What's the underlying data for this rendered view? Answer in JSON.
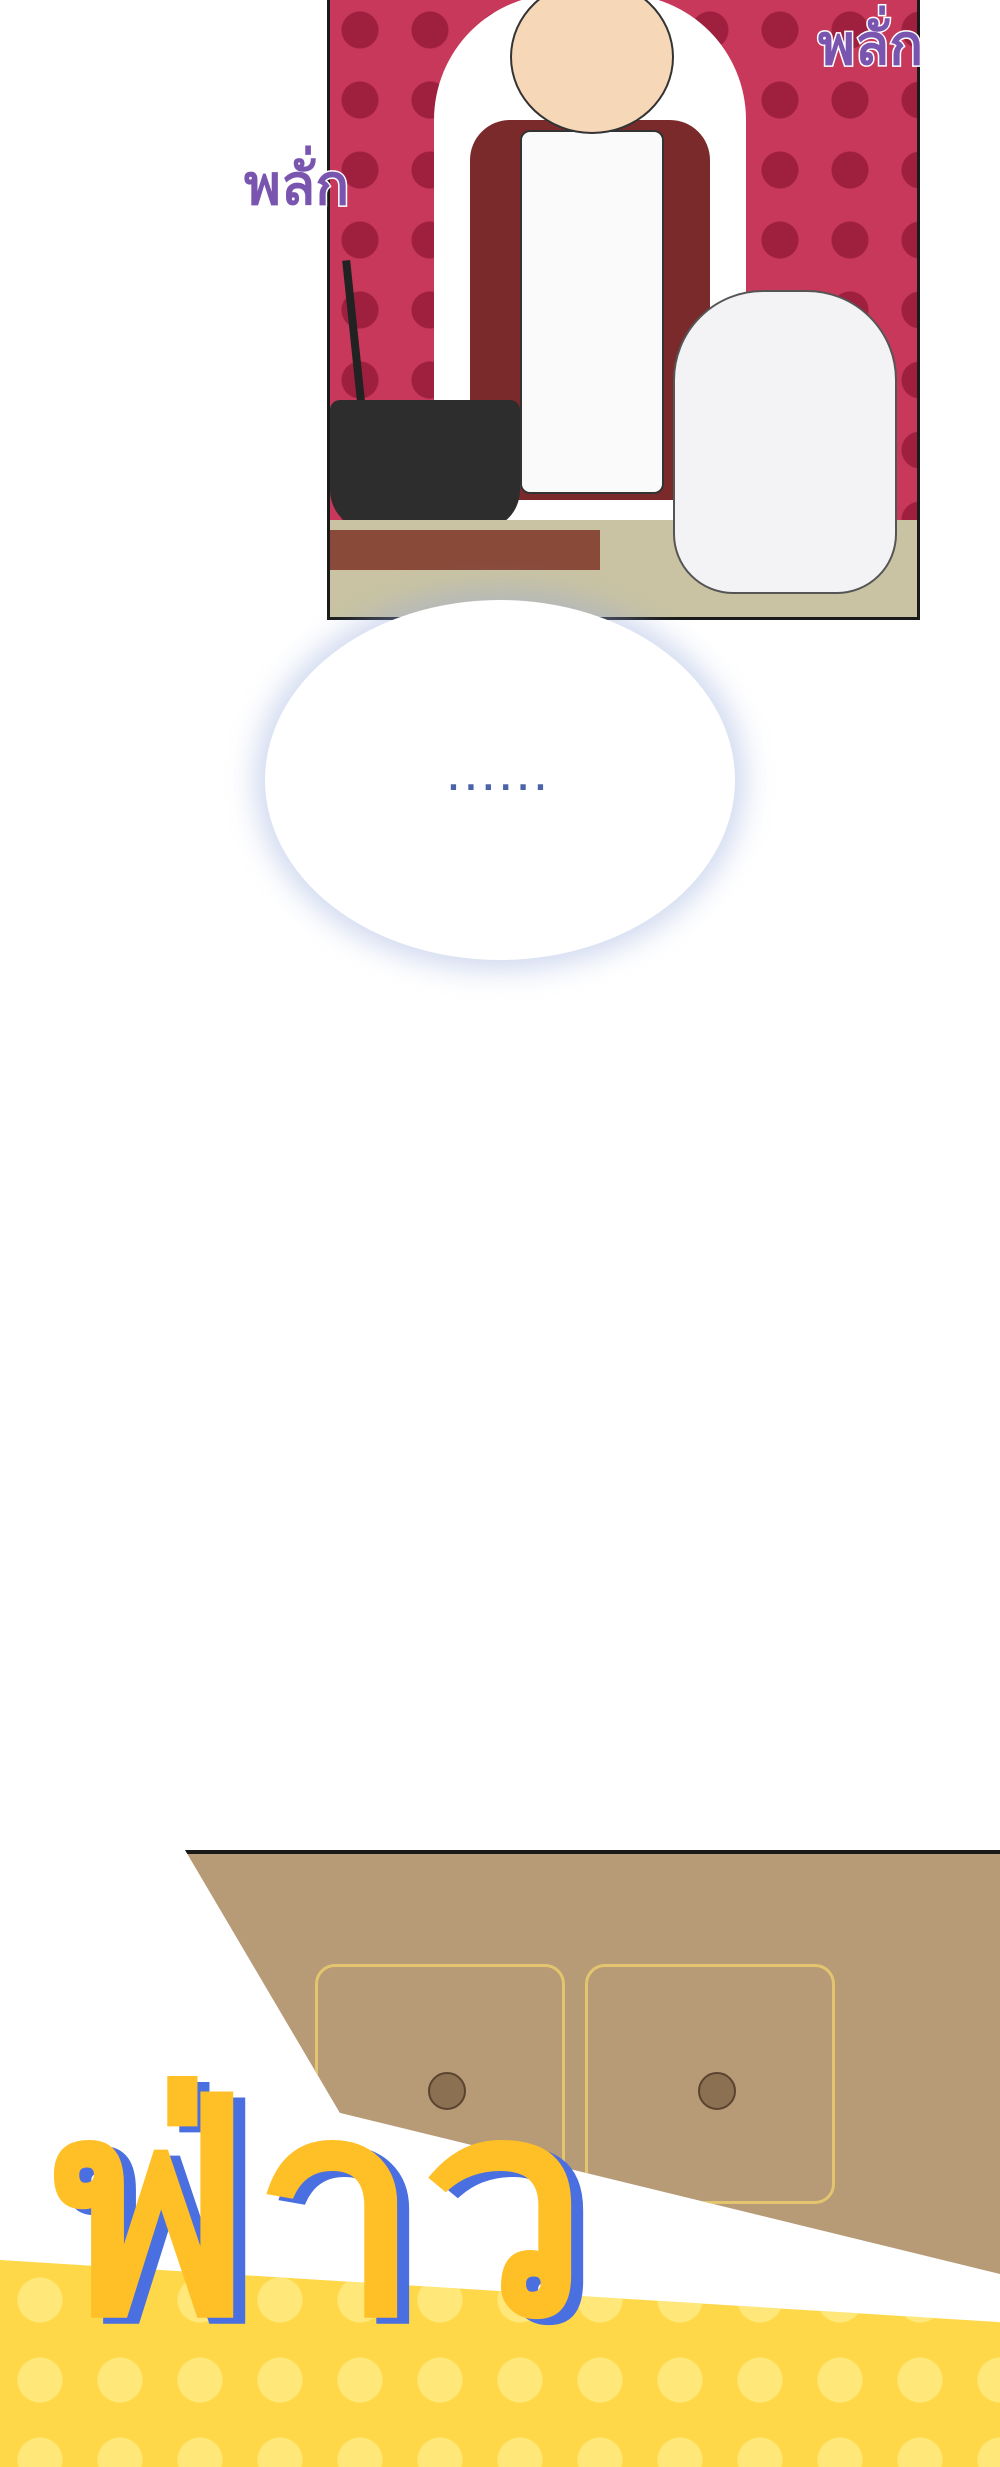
{
  "sfx": {
    "left": "พลั่ก",
    "right": "พลั่ก"
  },
  "bubble": {
    "text": "......"
  },
  "bottom_sfx": {
    "text": "ฟ่าว"
  }
}
